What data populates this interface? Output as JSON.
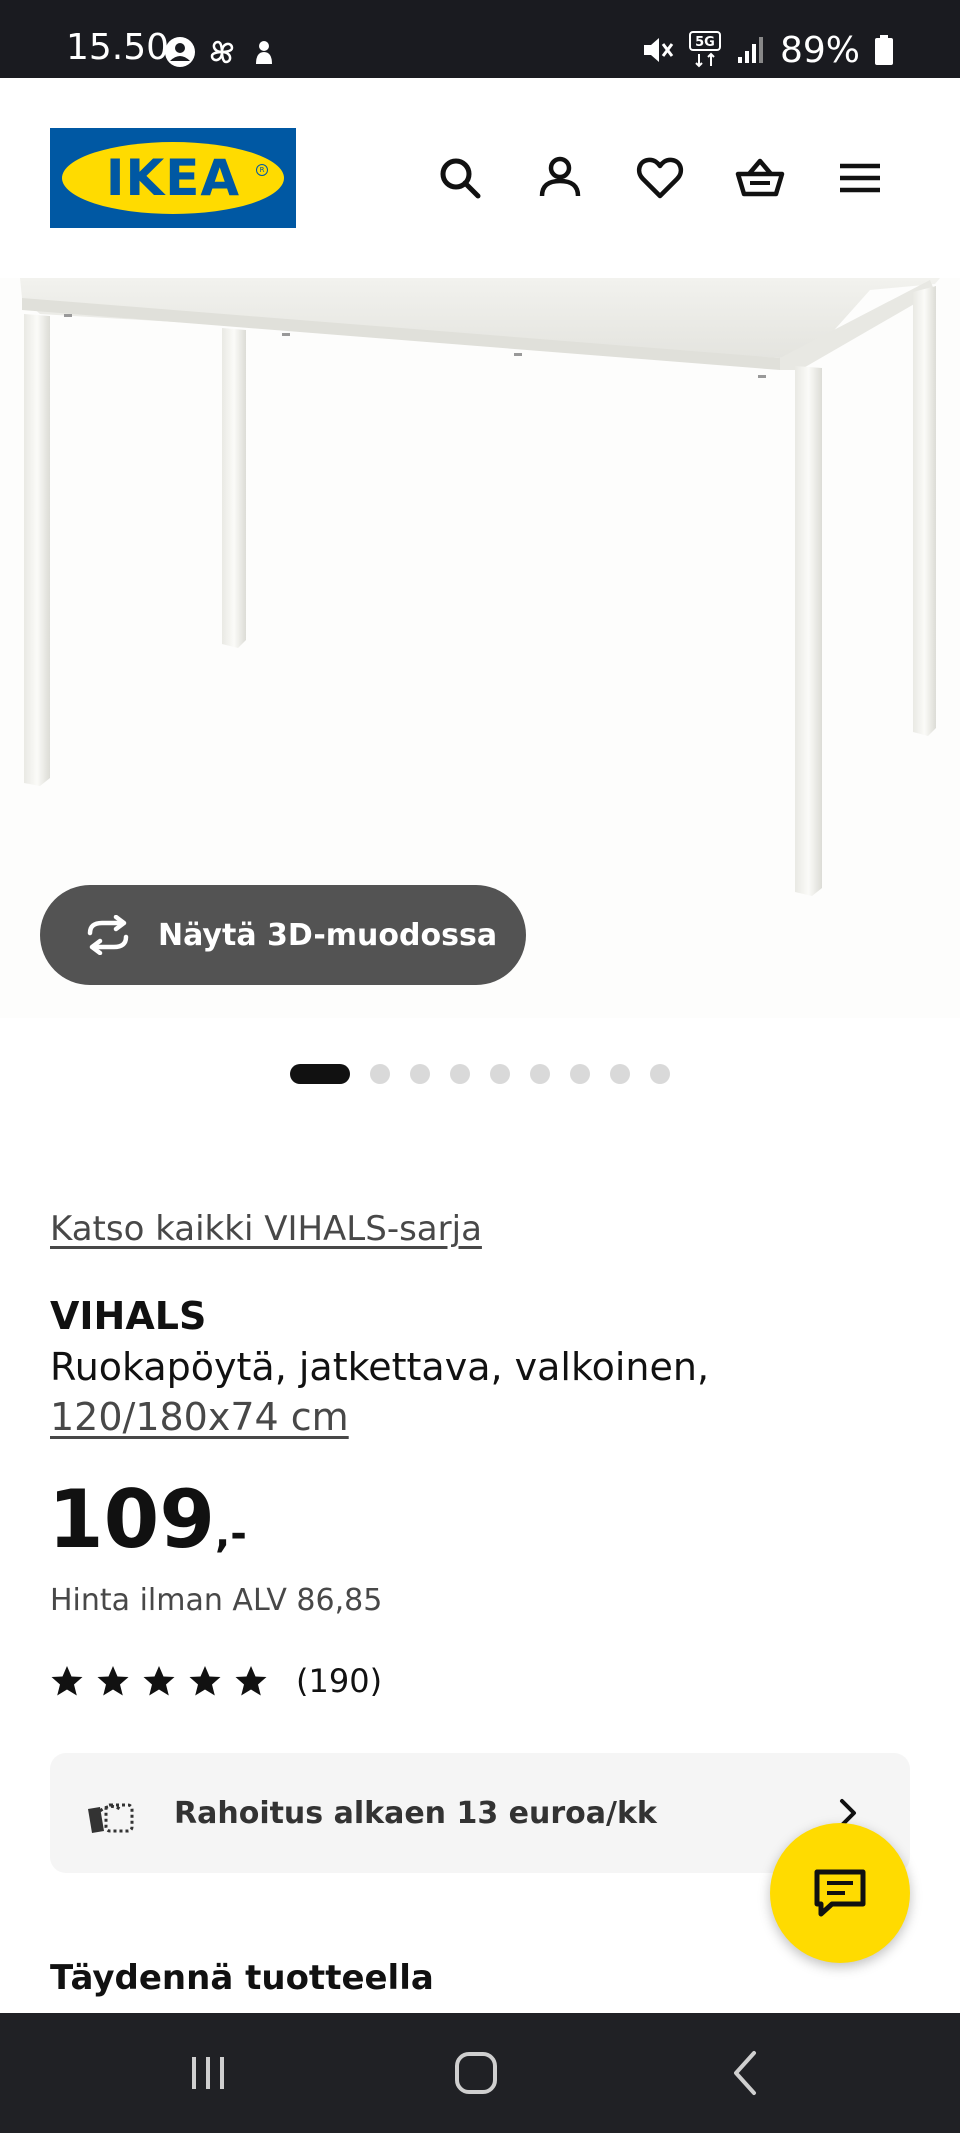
{
  "status_bar": {
    "time": "15.50",
    "left_icons": [
      "account-circle-icon",
      "pinwheel-icon",
      "app-notification-icon"
    ],
    "right_icons": [
      "mute-vibrate-icon",
      "5g-icon",
      "signal-icon",
      "battery-icon"
    ],
    "network": "5G",
    "battery": "89%"
  },
  "header": {
    "logo_text": "IKEA",
    "icons": [
      "search-icon",
      "account-icon",
      "heart-icon",
      "basket-icon",
      "menu-icon"
    ]
  },
  "gallery": {
    "view_3d_label": "Näytä 3D-muodossa",
    "image_count": 9,
    "active_index": 0
  },
  "product": {
    "series_link": "Katso kaikki VIHALS-sarja",
    "name": "VIHALS",
    "description": "Ruokapöytä, jatkettava, valkoinen,",
    "size": "120/180x74 cm",
    "price": "109",
    "price_suffix": ",-",
    "price_excl_vat": "Hinta ilman ALV 86,85",
    "rating_stars": 5,
    "review_count": "(190)"
  },
  "financing": {
    "label": "Rahoitus alkaen 13 euroa/kk"
  },
  "complement": {
    "heading": "Täydennä tuotteella"
  },
  "colors": {
    "ikea_blue": "#0058a3",
    "ikea_yellow": "#ffdb00",
    "status_bar_bg": "#1a1b20",
    "nav_bar_bg": "#202125",
    "button_3d_bg": "#535353"
  }
}
